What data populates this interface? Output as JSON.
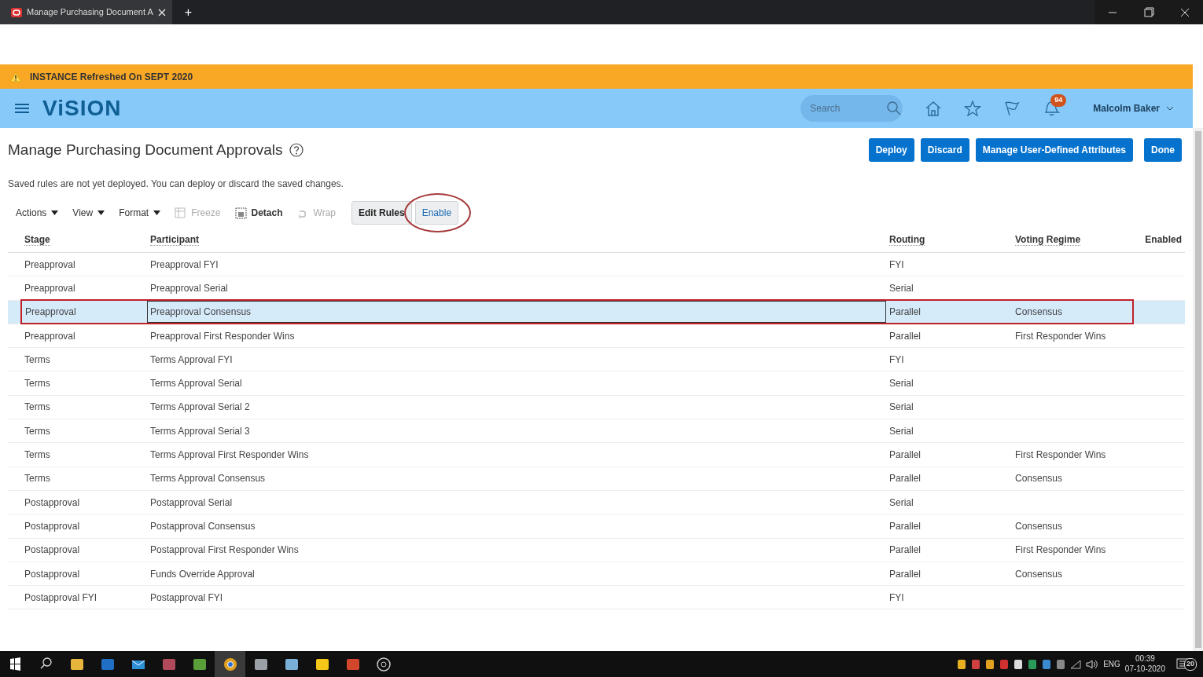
{
  "browser": {
    "tab_title": "Manage Purchasing Document A",
    "new_tab": "+"
  },
  "banner": {
    "text": "INSTANCE Refreshed On SEPT 2020"
  },
  "header": {
    "logo": "ViSION",
    "search": {
      "placeholder": "Search"
    },
    "notifications": "94",
    "user": "Malcolm Baker"
  },
  "page": {
    "title": "Manage Purchasing Document Approvals",
    "actions": [
      {
        "label": "Deploy",
        "kind": "primary"
      },
      {
        "label": "Discard",
        "kind": "primary"
      },
      {
        "label": "Manage User-Defined Attributes",
        "kind": "primary"
      },
      {
        "label": "Done",
        "kind": "done"
      }
    ],
    "message": "Saved rules are not yet deployed. You can deploy or discard the saved changes."
  },
  "toolbar": [
    {
      "label": "Actions",
      "kind": "menu",
      "disabled": false
    },
    {
      "label": "View",
      "kind": "menu",
      "disabled": false
    },
    {
      "label": "Format",
      "kind": "menu",
      "disabled": false
    },
    {
      "label": "Freeze",
      "kind": "freeze",
      "disabled": true
    },
    {
      "label": "Detach",
      "kind": "detach",
      "disabled": false
    },
    {
      "label": "Wrap",
      "kind": "wrap",
      "disabled": true
    },
    {
      "label": "Edit Rules",
      "kind": "button",
      "disabled": false
    },
    {
      "label": "Enable",
      "kind": "button",
      "disabled": false,
      "circled": true
    }
  ],
  "table": {
    "columns": [
      "Stage",
      "Participant",
      "Routing",
      "Voting Regime",
      "Enabled"
    ],
    "rows": [
      {
        "cells": [
          "Preapproval",
          "Preapproval FYI",
          "FYI",
          ""
        ],
        "selected": false,
        "outlined": false
      },
      {
        "cells": [
          "Preapproval",
          "Preapproval Serial",
          "Serial",
          ""
        ],
        "selected": false,
        "outlined": false
      },
      {
        "cells": [
          "Preapproval",
          "Preapproval Consensus",
          "Parallel",
          "Consensus"
        ],
        "selected": true,
        "outlined": true
      },
      {
        "cells": [
          "Preapproval",
          "Preapproval First Responder Wins",
          "Parallel",
          "First Responder Wins"
        ],
        "selected": false,
        "outlined": false
      },
      {
        "cells": [
          "Terms",
          "Terms Approval FYI",
          "FYI",
          ""
        ],
        "selected": false,
        "outlined": false
      },
      {
        "cells": [
          "Terms",
          "Terms Approval Serial",
          "Serial",
          ""
        ],
        "selected": false,
        "outlined": false
      },
      {
        "cells": [
          "Terms",
          "Terms Approval Serial 2",
          "Serial",
          ""
        ],
        "selected": false,
        "outlined": false
      },
      {
        "cells": [
          "Terms",
          "Terms Approval Serial 3",
          "Serial",
          ""
        ],
        "selected": false,
        "outlined": false
      },
      {
        "cells": [
          "Terms",
          "Terms Approval First Responder Wins",
          "Parallel",
          "First Responder Wins"
        ],
        "selected": false,
        "outlined": false
      },
      {
        "cells": [
          "Terms",
          "Terms Approval Consensus",
          "Parallel",
          "Consensus"
        ],
        "selected": false,
        "outlined": false
      },
      {
        "cells": [
          "Postapproval",
          "Postapproval Serial",
          "Serial",
          ""
        ],
        "selected": false,
        "outlined": false
      },
      {
        "cells": [
          "Postapproval",
          "Postapproval Consensus",
          "Parallel",
          "Consensus"
        ],
        "selected": false,
        "outlined": false
      },
      {
        "cells": [
          "Postapproval",
          "Postapproval First Responder Wins",
          "Parallel",
          "First Responder Wins"
        ],
        "selected": false,
        "outlined": false
      },
      {
        "cells": [
          "Postapproval",
          "Funds Override Approval",
          "Parallel",
          "Consensus"
        ],
        "selected": false,
        "outlined": false
      },
      {
        "cells": [
          "Postapproval FYI",
          "Postapproval FYI",
          "FYI",
          ""
        ],
        "selected": false,
        "outlined": false
      }
    ]
  },
  "taskbar": {
    "apps": [
      {
        "kind": "files",
        "selected": false
      },
      {
        "kind": "outlook",
        "selected": false
      },
      {
        "kind": "mail",
        "selected": false
      },
      {
        "kind": "snip",
        "selected": false
      },
      {
        "kind": "notepad",
        "selected": false
      },
      {
        "kind": "chrome",
        "selected": true
      },
      {
        "kind": "paint",
        "selected": false
      },
      {
        "kind": "book",
        "selected": false
      },
      {
        "kind": "notes",
        "selected": false
      },
      {
        "kind": "powerpoint",
        "selected": false
      },
      {
        "kind": "ring",
        "selected": false
      }
    ],
    "tray": [
      {
        "kind": "shield"
      },
      {
        "kind": "recorder"
      },
      {
        "kind": "chrome"
      },
      {
        "kind": "app"
      },
      {
        "kind": "mic"
      },
      {
        "kind": "security"
      },
      {
        "kind": "globe"
      },
      {
        "kind": "device"
      }
    ],
    "language": "ENG",
    "time": "00:39",
    "date": "07-10-2020",
    "notification_count": "20"
  }
}
